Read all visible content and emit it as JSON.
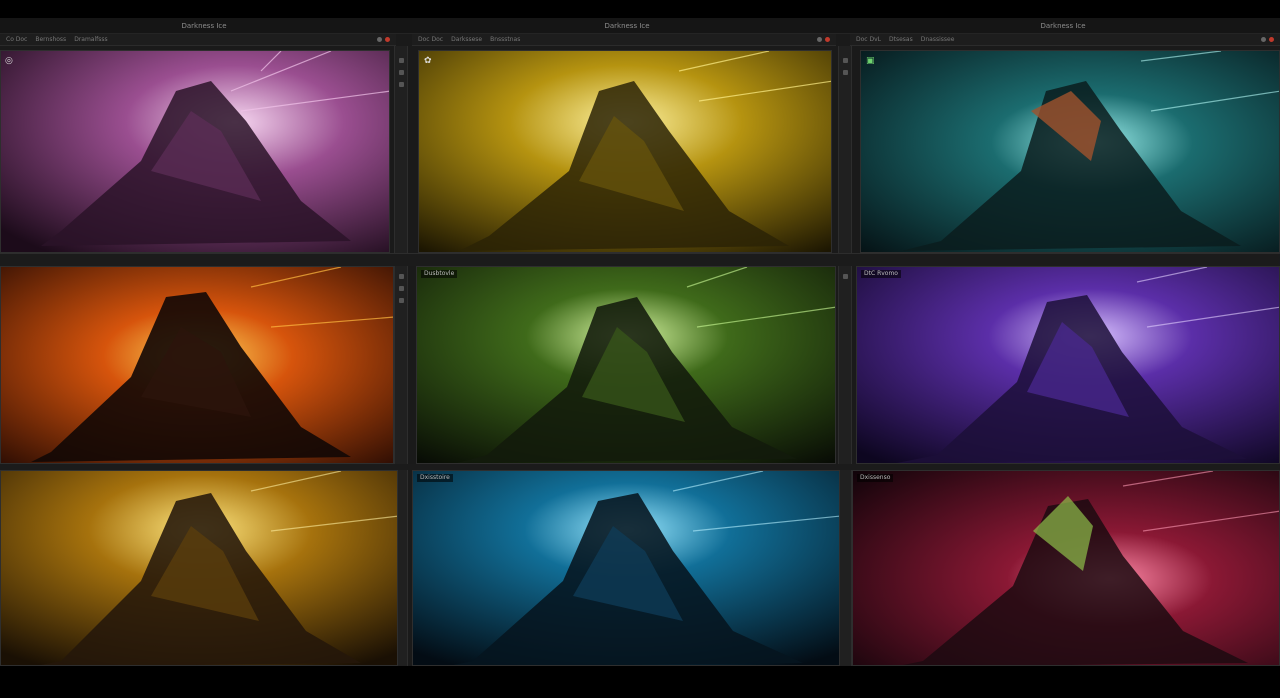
{
  "windows": [
    {
      "title": "Darkness Ice",
      "menu": [
        "Co  Doc",
        "Bernshoss",
        "Dramalfsss"
      ]
    },
    {
      "title": "Darkness Ice",
      "menu": [
        "Doc  Doc",
        "Darkssese",
        "Bnssstnas"
      ]
    },
    {
      "title": "Darkness Ice",
      "menu": [
        "Doc  DvL",
        "Dtsesas",
        "Dnassissee"
      ]
    }
  ],
  "panels": [
    {
      "name": "panel-magenta",
      "label": "",
      "accent": "#c87ad0"
    },
    {
      "name": "panel-yellow",
      "label": "",
      "accent": "#e8c21a"
    },
    {
      "name": "panel-cyan",
      "label": "",
      "accent": "#47d6d6"
    },
    {
      "name": "panel-fire",
      "label": "",
      "accent": "#ff6a10"
    },
    {
      "name": "panel-green",
      "label": "Dusbtovle",
      "accent": "#7ec23a"
    },
    {
      "name": "panel-violet",
      "label": "DtC Rvomo",
      "accent": "#8a4de0"
    },
    {
      "name": "panel-gold",
      "label": "",
      "accent": "#e6a812"
    },
    {
      "name": "panel-blue",
      "label": "Dxisstoire",
      "accent": "#22a8e0"
    },
    {
      "name": "panel-crimson",
      "label": "Dxissenso",
      "accent": "#e0305a"
    }
  ],
  "icons": [
    "window-controls-icon",
    "tool-icon",
    "sidebar-buttons"
  ]
}
